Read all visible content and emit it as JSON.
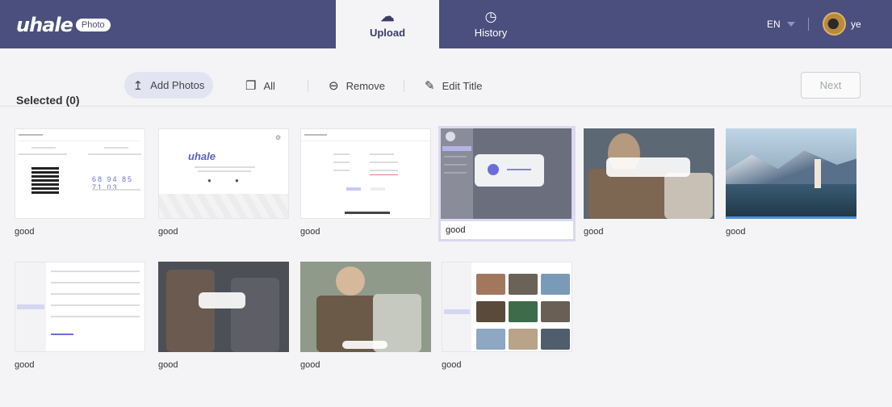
{
  "header": {
    "logo_word": "uhale",
    "logo_badge": "Photo",
    "tabs": [
      {
        "label": "Upload",
        "icon": "cloud-upload-icon",
        "active": true
      },
      {
        "label": "History",
        "icon": "clock-icon",
        "active": false
      }
    ],
    "language": "EN",
    "username": "ye"
  },
  "toolbar": {
    "selected_label": "Selected (0)",
    "add_photos": "Add Photos",
    "all": "All",
    "remove": "Remove",
    "edit_title": "Edit Title",
    "next": "Next"
  },
  "photos": [
    {
      "caption": "good"
    },
    {
      "caption": "good"
    },
    {
      "caption": "good"
    },
    {
      "caption": "good",
      "selected": true,
      "editing": true
    },
    {
      "caption": "good"
    },
    {
      "caption": "good"
    },
    {
      "caption": "good"
    },
    {
      "caption": "good"
    },
    {
      "caption": "good"
    },
    {
      "caption": "good"
    }
  ],
  "thumb_text": {
    "t1_numbers": "68 94 85 71 03",
    "t2_logo": "uhale"
  },
  "colors": {
    "header_bg": "#4b4f7e",
    "accent": "#6b6ed8",
    "selected_card": "#d9d9f0"
  }
}
